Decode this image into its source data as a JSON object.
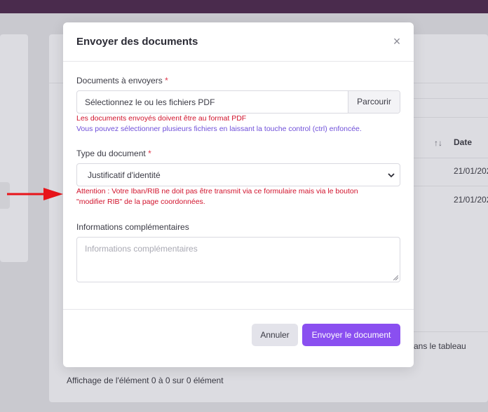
{
  "background": {
    "table_header_date": "Date",
    "sort_icon": "↑↓",
    "row_dates": [
      "21/01/202",
      "21/01/202"
    ],
    "empty_text": "ans le tableau",
    "info_text": "Affichage de l'élément 0 à 0 sur 0 élément"
  },
  "modal": {
    "title": "Envoyer des documents",
    "close_symbol": "×",
    "documents": {
      "label": "Documents à envoyers",
      "required_mark": "*",
      "placeholder": "Sélectionnez le ou les fichiers PDF",
      "browse_label": "Parcourir",
      "help_red": "Les documents envoyés doivent être au format PDF",
      "help_purple": "Vous pouvez sélectionner plusieurs fichiers en laissant la touche control (ctrl) enfoncée."
    },
    "type": {
      "label": "Type du document",
      "required_mark": "*",
      "selected": "Justificatif d'identité",
      "warning_line1": "Attention : Votre Iban/RIB ne doit pas être transmit via ce formulaire mais via le bouton",
      "warning_line2": "\"modifier RIB\" de la page coordonnées."
    },
    "info": {
      "label": "Informations complémentaires",
      "placeholder": "Informations complémentaires"
    },
    "buttons": {
      "cancel": "Annuler",
      "send": "Envoyer le document"
    }
  },
  "colors": {
    "accent": "#8a4ff0",
    "error": "#d1132c",
    "hint": "#6f4fd9",
    "topbar": "#4a2b4d",
    "arrow": "#e8141a"
  }
}
